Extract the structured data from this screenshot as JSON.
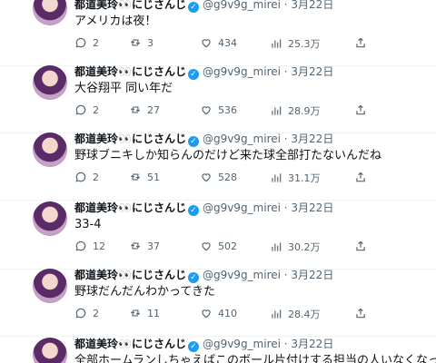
{
  "tweets": [
    {
      "name": "都道美玲👀にじさんじ",
      "handle": "@g9v9g_mirei · 3月22日",
      "text": "アメリカは夜！",
      "replies": "2",
      "retweets": "3",
      "likes": "434",
      "views": "25.3万"
    },
    {
      "name": "都道美玲👀にじさんじ",
      "handle": "@g9v9g_mirei · 3月22日",
      "text": "大谷翔平 同い年だ",
      "replies": "2",
      "retweets": "27",
      "likes": "536",
      "views": "28.9万"
    },
    {
      "name": "都道美玲👀にじさんじ",
      "handle": "@g9v9g_mirei · 3月22日",
      "text": "野球ブニキしか知らんのだけど来た球全部打たないんだね",
      "replies": "2",
      "retweets": "51",
      "likes": "528",
      "views": "31.1万"
    },
    {
      "name": "都道美玲👀にじさんじ",
      "handle": "@g9v9g_mirei · 3月22日",
      "text": "33-4",
      "replies": "12",
      "retweets": "37",
      "likes": "502",
      "views": "30.2万"
    },
    {
      "name": "都道美玲👀にじさんじ",
      "handle": "@g9v9g_mirei · 3月22日",
      "text": "野球だんだんわかってきた",
      "replies": "2",
      "retweets": "11",
      "likes": "410",
      "views": "28.4万"
    },
    {
      "name": "都道美玲👀にじさんじ",
      "handle": "@g9v9g_mirei · 3月22日",
      "text": "全部ホームランしちゃえばこのボール片付けする担当の人いなくなって楽",
      "replies": "",
      "retweets": "",
      "likes": "",
      "views": ""
    }
  ],
  "icons": {
    "reply": "reply-icon",
    "retweet": "retweet-icon",
    "like": "heart-icon",
    "views": "views-icon",
    "share": "share-icon",
    "verified": "verified-badge-icon"
  },
  "colors": {
    "text": "#0f1419",
    "secondary": "#536471",
    "verified": "#1d9bf0",
    "divider": "#eff3f4"
  }
}
